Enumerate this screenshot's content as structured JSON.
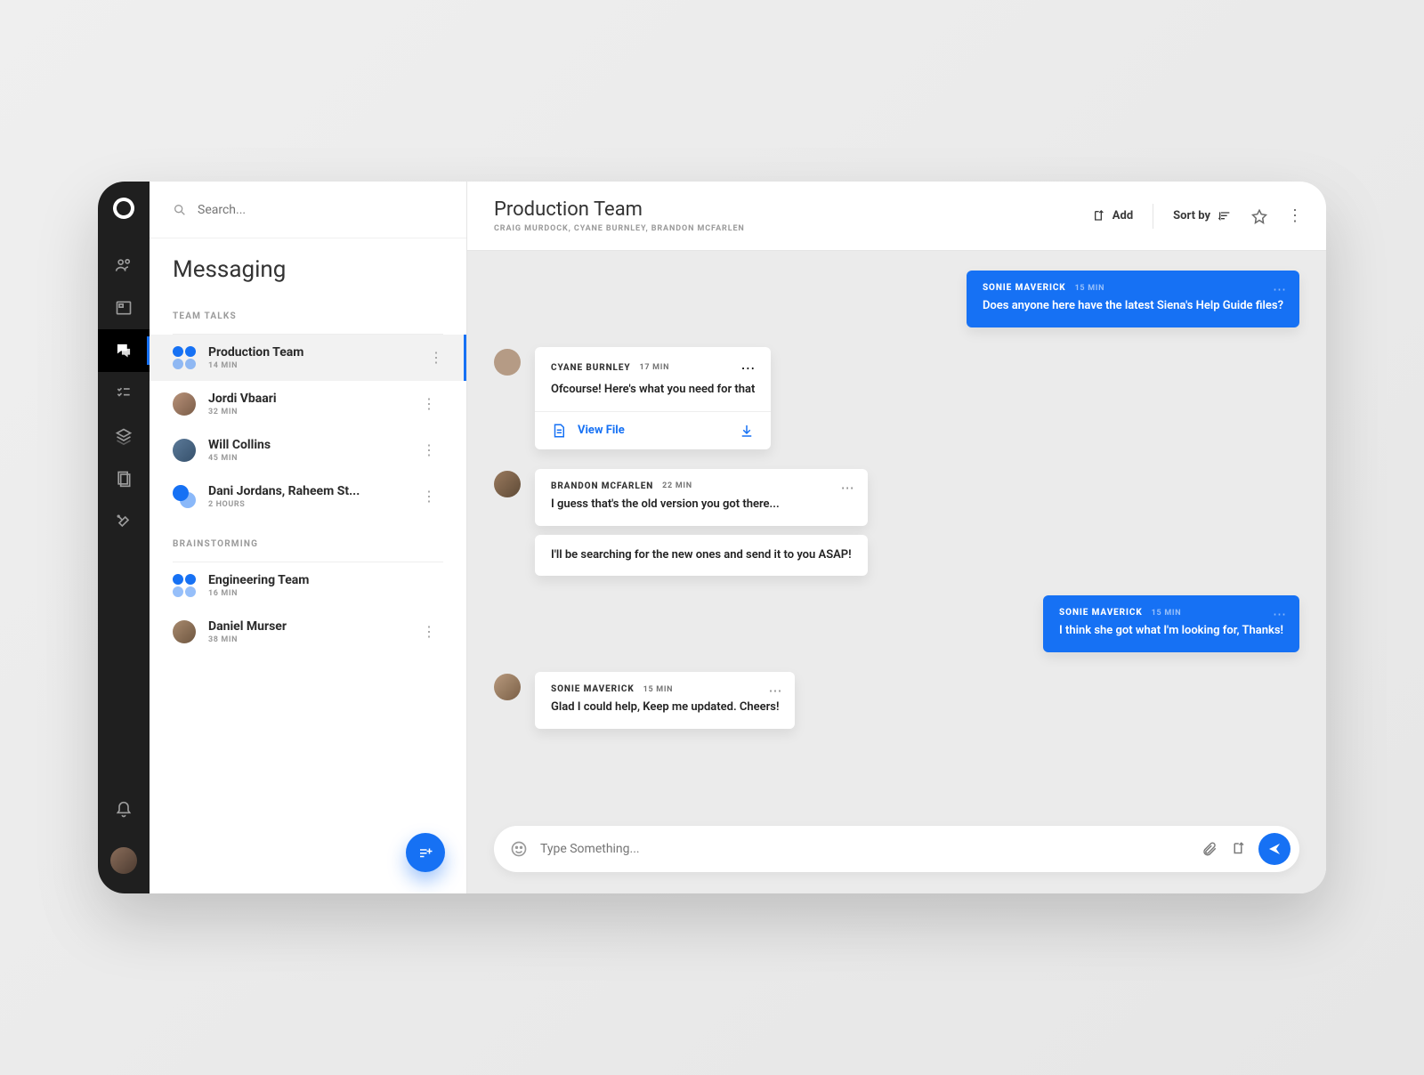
{
  "search": {
    "placeholder": "Search..."
  },
  "sidebar": {
    "title": "Messaging",
    "groups": {
      "team_talks": "TEAM TALKS",
      "brainstorming": "BRAINSTORMING"
    },
    "items": [
      {
        "name": "Production Team",
        "time": "14 MIN"
      },
      {
        "name": "Jordi Vbaari",
        "time": "32 MIN"
      },
      {
        "name": "Will Collins",
        "time": "45 MIN"
      },
      {
        "name": "Dani Jordans, Raheem St...",
        "time": "2 HOURS"
      },
      {
        "name": "Engineering Team",
        "time": "16 MIN"
      },
      {
        "name": "Daniel Murser",
        "time": "38 MIN"
      }
    ]
  },
  "topbar": {
    "title": "Production Team",
    "subtitle": "CRAIG MURDOCK, CYANE BURNLEY, BRANDON MCFARLEN",
    "add_label": "Add",
    "sort_label": "Sort by"
  },
  "messages": {
    "m0": {
      "name": "SONIE MAVERICK",
      "time": "15 MIN",
      "text": "Does anyone here have the latest Siena's Help Guide files?"
    },
    "m1": {
      "name": "CYANE BURNLEY",
      "time": "17 MIN",
      "text": "Ofcourse! Here's what you need for that",
      "file_label": "View File"
    },
    "m2": {
      "name": "BRANDON MCFARLEN",
      "time": "22 MIN",
      "text": "I guess that's the old version you got there..."
    },
    "m2b": {
      "text": "I'll be searching for the new ones and send it to you ASAP!"
    },
    "m3": {
      "name": "SONIE MAVERICK",
      "time": "15 MIN",
      "text": "I think she got what I'm looking for, Thanks!"
    },
    "m4": {
      "name": "SONIE MAVERICK",
      "time": "15 MIN",
      "text": "Glad I could help, Keep me updated. Cheers!"
    }
  },
  "composer": {
    "placeholder": "Type Something..."
  }
}
